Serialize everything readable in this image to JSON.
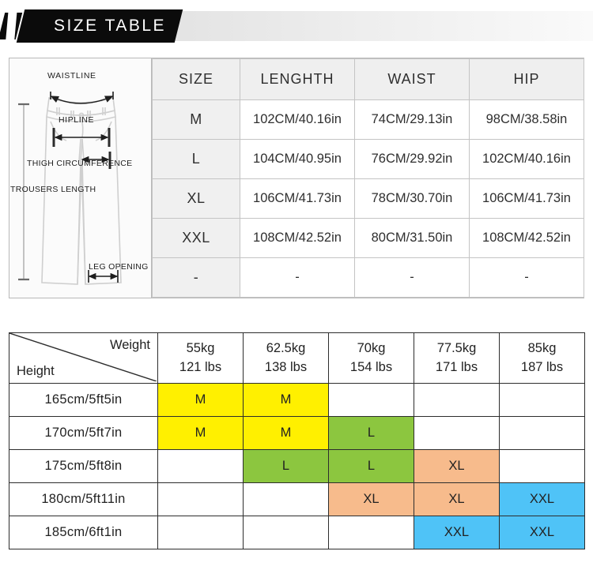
{
  "banner": {
    "title": "SIZE TABLE"
  },
  "diagram": {
    "name": "trousers-measurement-diagram",
    "labels": {
      "waistline": "WAISTLINE",
      "hipline": "HIPLINE",
      "thigh": "THIGH CIRCUMFERENCE",
      "trousers_length": "TROUSERS LENGTH",
      "leg_opening": "LEG OPENING"
    }
  },
  "size_table": {
    "headers": [
      "SIZE",
      "LENGHTH",
      "WAIST",
      "HIP"
    ],
    "rows": [
      {
        "size": "M",
        "length": "102CM/40.16in",
        "waist": "74CM/29.13in",
        "hip": "98CM/38.58in"
      },
      {
        "size": "L",
        "length": "104CM/40.95in",
        "waist": "76CM/29.92in",
        "hip": "102CM/40.16in"
      },
      {
        "size": "XL",
        "length": "106CM/41.73in",
        "waist": "78CM/30.70in",
        "hip": "106CM/41.73in"
      },
      {
        "size": "XXL",
        "length": "108CM/42.52in",
        "waist": "80CM/31.50in",
        "hip": "108CM/42.52in"
      },
      {
        "size": "-",
        "length": "-",
        "waist": "-",
        "hip": "-"
      }
    ]
  },
  "fit_matrix": {
    "corner": {
      "weight_label": "Weight",
      "height_label": "Height"
    },
    "weights": [
      {
        "kg": "55kg",
        "lbs": "121 lbs"
      },
      {
        "kg": "62.5kg",
        "lbs": "138 lbs"
      },
      {
        "kg": "70kg",
        "lbs": "154 lbs"
      },
      {
        "kg": "77.5kg",
        "lbs": "171 lbs"
      },
      {
        "kg": "85kg",
        "lbs": "187 lbs"
      }
    ],
    "heights": [
      "165cm/5ft5in",
      "170cm/5ft7in",
      "175cm/5ft8in",
      "180cm/5ft11in",
      "185cm/6ft1in"
    ],
    "cells": [
      [
        {
          "label": "M",
          "color": "#FFF000"
        },
        {
          "label": "M",
          "color": "#FFF000"
        },
        {
          "label": "",
          "color": "#FFFFFF"
        },
        {
          "label": "",
          "color": "#FFFFFF"
        },
        {
          "label": "",
          "color": "#FFFFFF"
        }
      ],
      [
        {
          "label": "M",
          "color": "#FFF000"
        },
        {
          "label": "M",
          "color": "#FFF000"
        },
        {
          "label": "L",
          "color": "#8CC63F"
        },
        {
          "label": "",
          "color": "#FFFFFF"
        },
        {
          "label": "",
          "color": "#FFFFFF"
        }
      ],
      [
        {
          "label": "",
          "color": "#FFFFFF"
        },
        {
          "label": "L",
          "color": "#8CC63F"
        },
        {
          "label": "L",
          "color": "#8CC63F"
        },
        {
          "label": "XL",
          "color": "#F7BB8C"
        },
        {
          "label": "",
          "color": "#FFFFFF"
        }
      ],
      [
        {
          "label": "",
          "color": "#FFFFFF"
        },
        {
          "label": "",
          "color": "#FFFFFF"
        },
        {
          "label": "XL",
          "color": "#F7BB8C"
        },
        {
          "label": "XL",
          "color": "#F7BB8C"
        },
        {
          "label": "XXL",
          "color": "#4FC3F7"
        }
      ],
      [
        {
          "label": "",
          "color": "#FFFFFF"
        },
        {
          "label": "",
          "color": "#FFFFFF"
        },
        {
          "label": "",
          "color": "#FFFFFF"
        },
        {
          "label": "XXL",
          "color": "#4FC3F7"
        },
        {
          "label": "XXL",
          "color": "#4FC3F7"
        }
      ]
    ]
  },
  "colors": {
    "yellow": "#FFF000",
    "green": "#8CC63F",
    "orange": "#F7BB8C",
    "blue": "#4FC3F7",
    "banner_black": "#0B0B0B",
    "header_gray": "#EFEFEF"
  }
}
